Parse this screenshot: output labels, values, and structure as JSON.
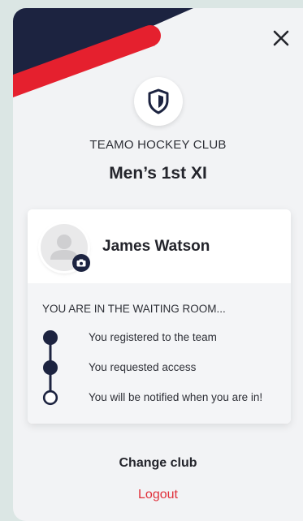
{
  "club": {
    "name": "TEAMO HOCKEY CLUB",
    "team": "Men’s 1st XI"
  },
  "user": {
    "name": "James Watson"
  },
  "waiting": {
    "title": "YOU ARE IN THE WAITING ROOM...",
    "steps": [
      {
        "label": "You registered to the team",
        "done": true
      },
      {
        "label": "You requested access",
        "done": true
      },
      {
        "label": "You will be notified when you are in!",
        "done": false
      }
    ]
  },
  "actions": {
    "change_club": "Change club",
    "logout": "Logout"
  },
  "icons": {
    "close": "close-icon",
    "shield": "shield-icon",
    "avatar": "user-placeholder-icon",
    "camera": "camera-icon"
  },
  "colors": {
    "navy": "#1c2340",
    "red": "#e5202e",
    "logout": "#e0303a",
    "background": "#f2f3f5"
  }
}
